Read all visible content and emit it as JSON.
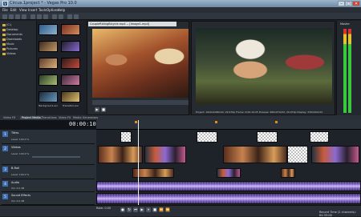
{
  "window": {
    "title": "Circus.1project * - Vegas Pro 10.0"
  },
  "menu": [
    "File",
    "Edit",
    "View",
    "Insert",
    "Tools",
    "Options",
    "Help"
  ],
  "explorer": {
    "tree": [
      "(C:)",
      "Desktop",
      "Documents",
      "Downloads",
      "Music",
      "Pictures",
      "Videos"
    ],
    "thumbnails": [
      "",
      "",
      "",
      "",
      "",
      "",
      "",
      "",
      "",
      "",
      "Background.avi",
      "Transition.avi"
    ]
  },
  "trimmer": {
    "filename": "CoupleRidingBicycle.mp4 -- [Image1.mp4]"
  },
  "preview": {
    "info": "Project: 1920x1080x32, 29.970p   Frame: 0:00:10;25   Preview: 480x270x32, 29.970p   Display: 339x190x32"
  },
  "master": {
    "label": "Master"
  },
  "tabs": {
    "items": [
      "Video FX",
      "Project Media",
      "Transitions",
      "Video FX",
      "Media Generators"
    ],
    "active_index": 1
  },
  "timeline": {
    "timecode": "00:00:10;25",
    "tracks": [
      {
        "num": "1",
        "name": "Titles",
        "level": "Level: 100.0 %",
        "color": "#3d6fb0"
      },
      {
        "num": "2",
        "name": "Videos",
        "level": "Level: 100.0 %",
        "color": "#3d6fb0"
      },
      {
        "num": "3",
        "name": "B-Roll",
        "level": "Level: 100.0 %",
        "color": "#3d6fb0"
      },
      {
        "num": "4",
        "name": "Audio",
        "level": "Vol: 0.0 dB",
        "color": "#3d6fb0"
      },
      {
        "num": "5",
        "name": "Sound Effects",
        "level": "Vol: 0.0 dB",
        "color": "#3d6fb0"
      }
    ]
  },
  "status": {
    "rate": "Rate: 0.00",
    "time": "Record Time (2 channels): 84:35:08"
  }
}
